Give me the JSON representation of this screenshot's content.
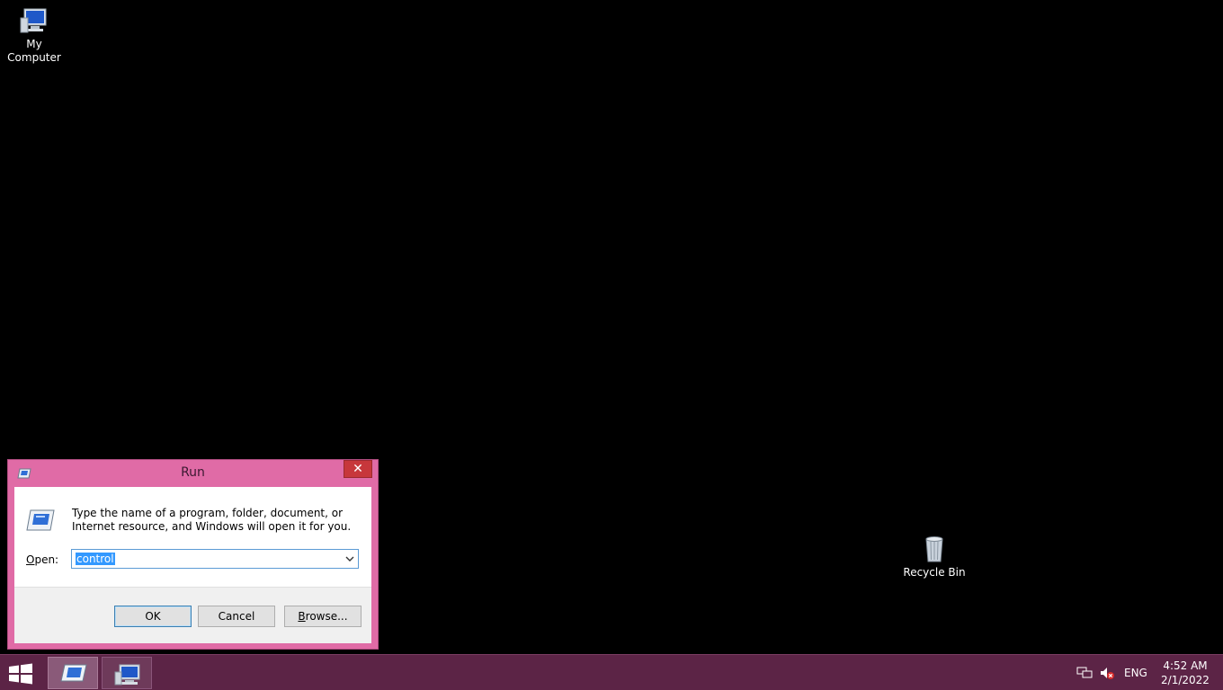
{
  "desktop": {
    "icons": [
      {
        "label": "My\nComputer",
        "icon": "computer-icon"
      },
      {
        "label": "Recycle Bin",
        "icon": "recycle-bin-icon"
      }
    ],
    "my_computer_line1": "My",
    "my_computer_line2": "Computer",
    "recycle_bin": "Recycle Bin"
  },
  "run_dialog": {
    "title": "Run",
    "close_symbol": "✕",
    "description": "Type the name of a program, folder, document, or Internet resource, and Windows will open it for you.",
    "open_label_prefix": "O",
    "open_label_rest": "pen:",
    "open_value": "control",
    "buttons": {
      "ok": "OK",
      "cancel": "Cancel",
      "browse_prefix": "B",
      "browse_rest": "rowse..."
    }
  },
  "taskbar": {
    "items": [
      {
        "name": "Run",
        "icon": "run-icon",
        "active": true
      },
      {
        "name": "Computer",
        "icon": "computer-icon",
        "active": false
      }
    ],
    "tray": {
      "language": "ENG",
      "time": "4:52 AM",
      "date": "2/1/2022"
    }
  },
  "colors": {
    "accent": "#e06ba6",
    "taskbar": "#5c2446",
    "close": "#c7373b",
    "selection": "#3399ff"
  }
}
